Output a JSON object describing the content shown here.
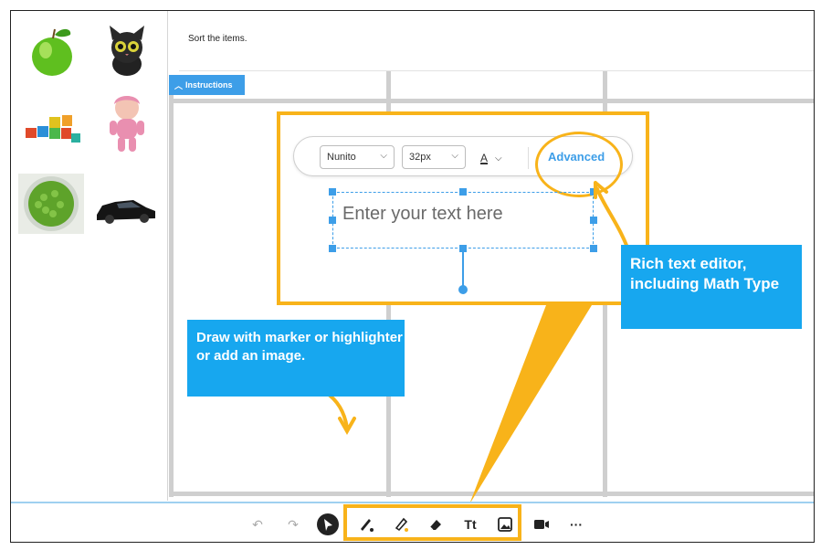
{
  "prompt": {
    "text": "Sort the items."
  },
  "instructions_button": {
    "label": "Instructions"
  },
  "items": [
    {
      "name": "apple"
    },
    {
      "name": "cat"
    },
    {
      "name": "blocks"
    },
    {
      "name": "doll"
    },
    {
      "name": "peas"
    },
    {
      "name": "car"
    }
  ],
  "text_toolbar": {
    "font_family": "Nunito",
    "font_size": "32px",
    "color_label": "A",
    "advanced_label": "Advanced"
  },
  "textbox": {
    "placeholder": "Enter your text here"
  },
  "notes": {
    "rich_text": "Rich text editor, including Math Type",
    "draw": "Draw with marker or highlighter or add an image."
  },
  "bottom_toolbar": {
    "text_tool_label": "Tt",
    "more_label": "···"
  },
  "colors": {
    "accent": "#3d9ee8",
    "callout": "#f8b31a",
    "note_bg": "#17a7ef"
  }
}
